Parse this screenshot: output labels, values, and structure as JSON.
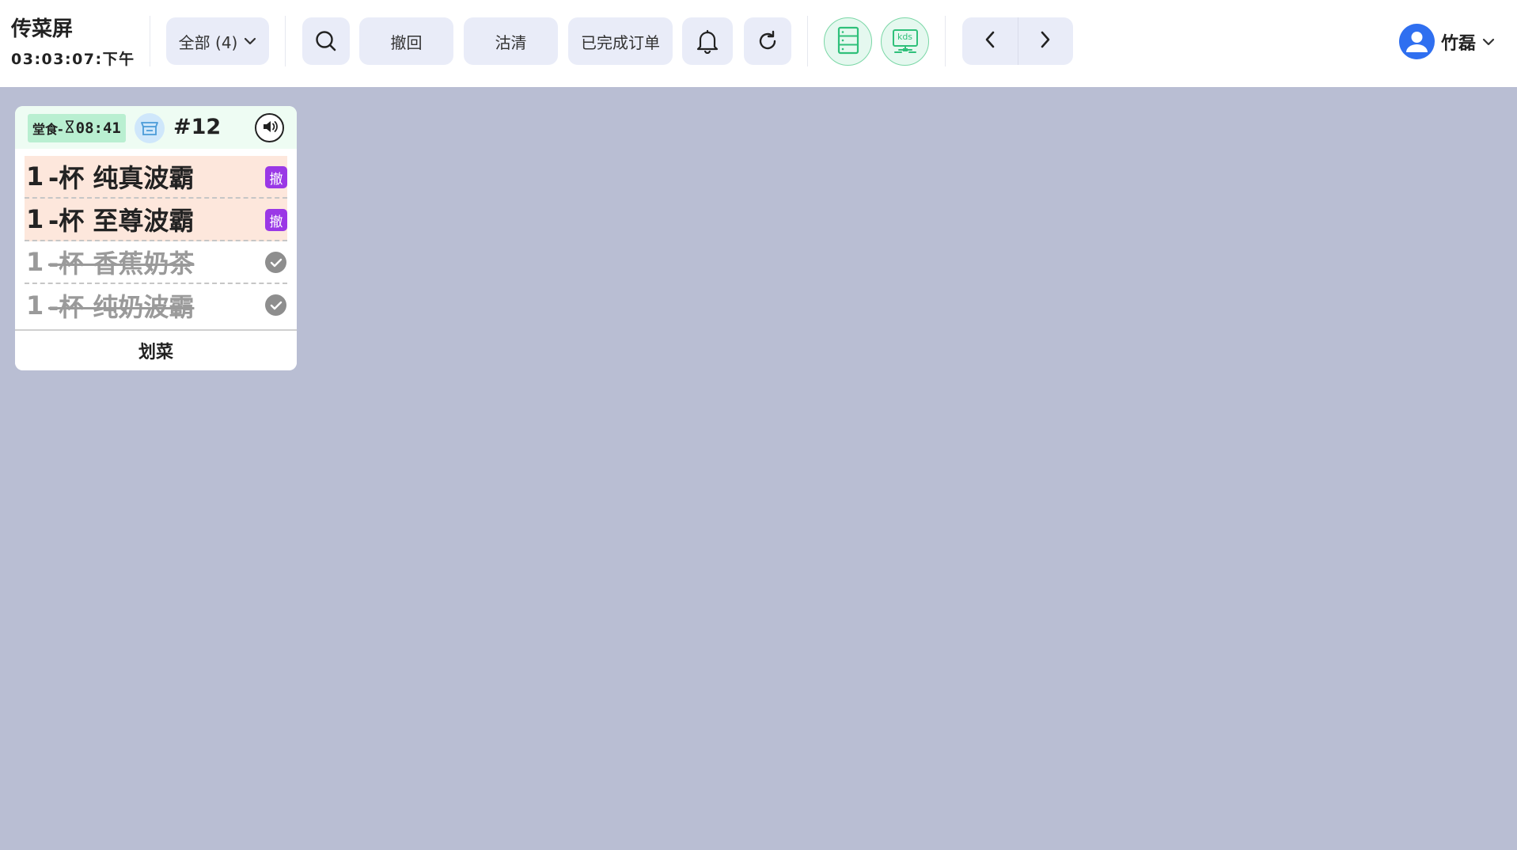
{
  "header": {
    "title": "传菜屏",
    "clock": "03:03:07:下午",
    "filter_label": "全部 (4)",
    "buttons": {
      "revoke": "撤回",
      "soldout": "沽清",
      "completed_orders": "已完成订单"
    },
    "kds_label": "kds",
    "user_name": "竹磊"
  },
  "order_card": {
    "dine_type": "堂食-",
    "timer": "08:41",
    "order_number": "#12",
    "items": [
      {
        "qty": "1",
        "name": "-杯 纯真波霸",
        "status": "pending",
        "tag": "撤"
      },
      {
        "qty": "1",
        "name": "-杯 至尊波霸",
        "status": "pending",
        "tag": "撤"
      },
      {
        "qty": "1",
        "name": "-杯 香蕉奶茶",
        "status": "done"
      },
      {
        "qty": "1",
        "name": "-杯 纯奶波霸",
        "status": "done"
      }
    ],
    "action_label": "划菜"
  },
  "colors": {
    "background": "#b9bed3",
    "button_bg": "#e9ecf8",
    "pending_row": "#fde7dc",
    "revoke_tag": "#9a38e6",
    "accent_green": "#2fc07a",
    "avatar_blue": "#2f6ff0"
  }
}
